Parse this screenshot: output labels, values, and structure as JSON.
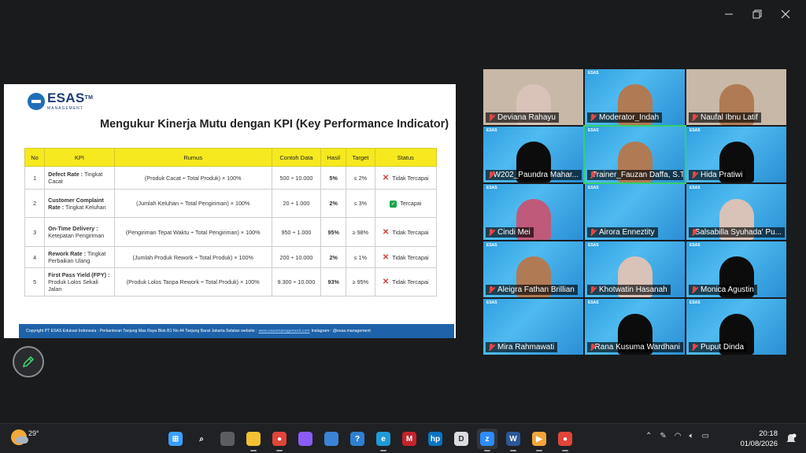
{
  "slide": {
    "logo_text": "ESAS",
    "logo_tm": "TM",
    "logo_sub": "MANAGEMENT",
    "title": "Mengukur Kinerja Mutu dengan KPI (Key Performance Indicator)",
    "table": {
      "headers": [
        "No",
        "KPI",
        "Rumus",
        "Contoh Data",
        "Hasil",
        "Target",
        "Status"
      ],
      "rows": [
        {
          "no": "1",
          "kpi_bold": "Defect Rate :",
          "kpi_rest": "Tingkat Cacat",
          "rumus": "(Produk Cacat ÷ Total Produk) × 100%",
          "contoh": "500 ÷ 10.000",
          "hasil": "5%",
          "target": "≤ 2%",
          "status": "Tidak Tercapai",
          "status_icon": "x-icon"
        },
        {
          "no": "2",
          "kpi_bold": "Customer Complaint Rate :",
          "kpi_rest": "Tingkat Keluhan",
          "rumus": "(Jumlah Keluhan ÷ Total Pengiriman) × 100%",
          "contoh": "20 ÷ 1.000",
          "hasil": "2%",
          "target": "≤ 3%",
          "status": "Tercapai",
          "status_icon": "check-icon"
        },
        {
          "no": "3",
          "kpi_bold": "On-Time Delivery :",
          "kpi_rest": "Ketepatan Pengiriman",
          "rumus": "(Pengiriman Tepat Waktu ÷ Total Pengiriman) × 100%",
          "contoh": "950 ÷ 1.000",
          "hasil": "95%",
          "target": "≥ 98%",
          "status": "Tidak Tercapai",
          "status_icon": "x-icon"
        },
        {
          "no": "4",
          "kpi_bold": "Rework Rate :",
          "kpi_rest": "Tingkat Perbaikan Ulang",
          "rumus": "(Jumlah Produk Rework ÷ Total Produk) × 100%",
          "contoh": "200 ÷ 10.000",
          "hasil": "2%",
          "target": "≤ 1%",
          "status": "Tidak Tercapai",
          "status_icon": "x-icon"
        },
        {
          "no": "5",
          "kpi_bold": "First Pass Yield (FPY) :",
          "kpi_rest": "Produk Lolos Sekali Jalan",
          "rumus": "(Produk Lolos Tanpa Rework ÷ Total Produk) × 100%",
          "contoh": "9.300 ÷ 10.000",
          "hasil": "93%",
          "target": "≥ 95%",
          "status": "Tidak Tercapai",
          "status_icon": "x-icon"
        }
      ]
    },
    "footer": {
      "text": "Copyright PT ESAS Edukasi Indonesia : Perkantoran Tanjung Mas Raya Blok B1 No.44 Tanjung Barat Jakarta Selatan website :",
      "link": "www.esasmanagement.com",
      "instagram": "Instagram : @esas.management"
    }
  },
  "gallery": {
    "participants": [
      {
        "name": "Deviana Rahayu",
        "style": "photo",
        "figure": "hijab2"
      },
      {
        "name": "Moderator_Indah",
        "style": "blue",
        "figure": "skin"
      },
      {
        "name": "Naufal Ibnu Latif",
        "style": "photo",
        "figure": "skin"
      },
      {
        "name": "W202_Paundra Mahar...",
        "style": "blue",
        "figure": "sil"
      },
      {
        "name": "Trainer_Fauzan Daffa, S.T.,...",
        "style": "blue",
        "figure": "skin",
        "active": true
      },
      {
        "name": "Hida Pratiwi",
        "style": "blue",
        "figure": "sil"
      },
      {
        "name": "Cindi Mei",
        "style": "blue",
        "figure": "hijab"
      },
      {
        "name": "Airora Enneztity",
        "style": "blue",
        "figure": "none"
      },
      {
        "name": "Salsabilla Syuhada' Pu...",
        "style": "blue",
        "figure": "hijab2"
      },
      {
        "name": "Aleigra Fathan Brillian",
        "style": "blue",
        "figure": "skin"
      },
      {
        "name": "Khotwatin Hasanah",
        "style": "blue",
        "figure": "hijab2"
      },
      {
        "name": "Monica Agustin",
        "style": "blue",
        "figure": "sil"
      },
      {
        "name": "Mira Rahmawati",
        "style": "blue",
        "figure": "none"
      },
      {
        "name": "Rana Kusuma Wardhani",
        "style": "blue",
        "figure": "sil"
      },
      {
        "name": "Puput Dinda",
        "style": "blue",
        "figure": "sil"
      }
    ],
    "tile_tag": "ESAS"
  },
  "taskbar": {
    "temperature": "29°",
    "apps": [
      "windows-start",
      "search",
      "task-view",
      "file-explorer",
      "chrome",
      "copilot",
      "store",
      "help",
      "edge",
      "mcafee",
      "hp",
      "dms",
      "zoom",
      "word",
      "media",
      "chrome-profile"
    ],
    "time": "20:18",
    "date": "01/08/2026"
  },
  "colors": {
    "accent_yellow": "#f6e91f",
    "brand_blue": "#1e62a9",
    "tile_blue": "#2aa3e0",
    "active_speaker": "#33d06b"
  }
}
